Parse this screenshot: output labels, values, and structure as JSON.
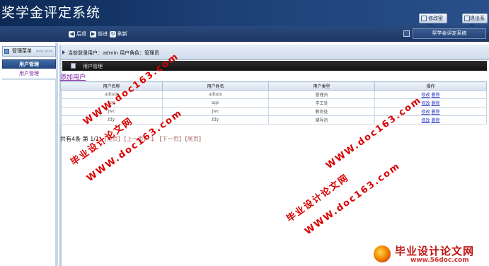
{
  "app": {
    "title": "奖学金评定系统"
  },
  "header": {
    "change_password": "修改密码",
    "logout": "退出系统"
  },
  "nav": {
    "back": "后退",
    "forward": "前进",
    "refresh": "刷新",
    "system_name": "奖学金评定系统"
  },
  "sidebar": {
    "title": "管理菜单",
    "title_en": "MAIN MENU",
    "group": "用户管理",
    "items": [
      {
        "label": "用户管理"
      }
    ]
  },
  "main": {
    "login_info": "当前登录用户：admin  用户角色：管理员",
    "breadcrumb": "用户管理",
    "add_user": "添加用户",
    "table": {
      "headers": [
        "用户名称",
        "用户姓名",
        "用户类型",
        "操作"
      ],
      "rows": [
        {
          "username": "admin",
          "name": "admin",
          "type": "管理员",
          "edit": "修改",
          "delete": "删除"
        },
        {
          "username": "xgc",
          "name": "xgc",
          "type": "学工处",
          "edit": "修改",
          "delete": "删除"
        },
        {
          "username": "jwc",
          "name": "jwc",
          "type": "教务处",
          "edit": "修改",
          "delete": "删除"
        },
        {
          "username": "fdy",
          "name": "fdy",
          "type": "辅导员",
          "edit": "修改",
          "delete": "删除"
        }
      ]
    },
    "pager": {
      "prefix": "共有4条 第",
      "page": "1/1",
      "first": "【首页】",
      "prev": "【上一页】",
      "current": "1",
      "next": "【下一页】",
      "last": "【尾页】"
    }
  },
  "watermark": {
    "site_cn": "毕业设计论文网",
    "site_url": "WWW.doc163.com",
    "logo_text": "毕业设计论文网",
    "logo_url": "www.56doc.com"
  }
}
